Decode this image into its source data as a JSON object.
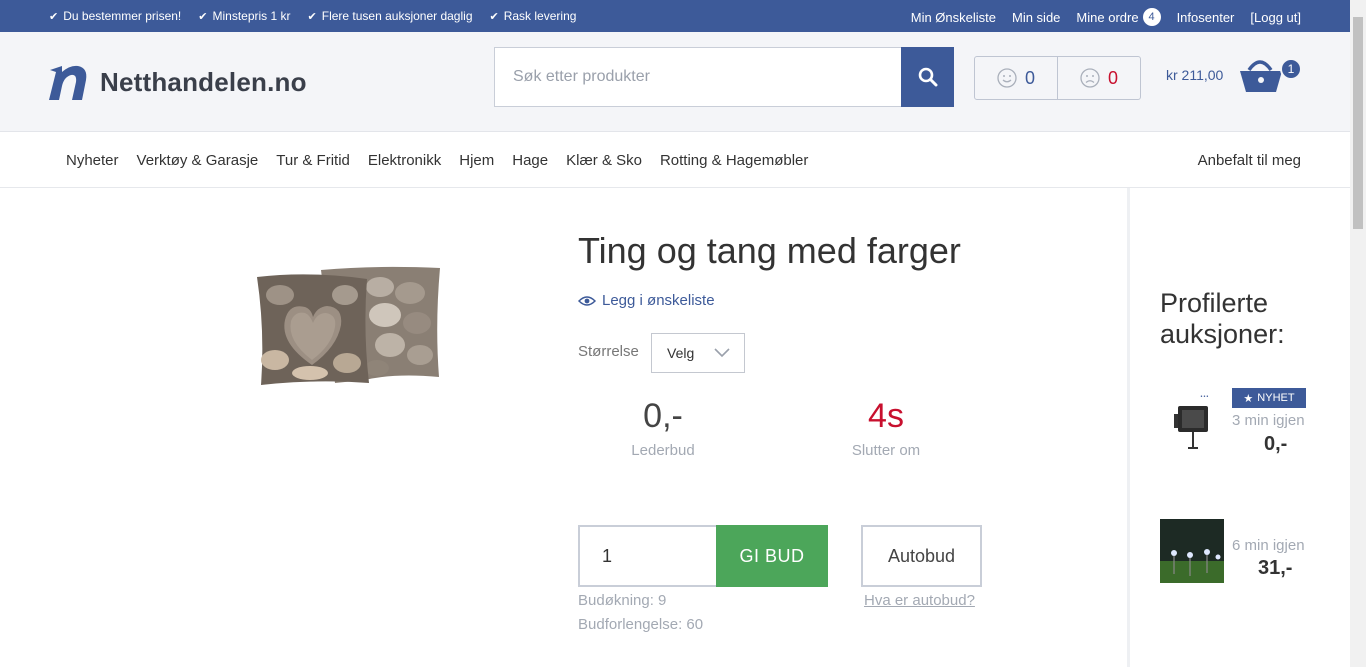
{
  "topbar": {
    "usps": [
      "Du bestemmer prisen!",
      "Minstepris 1 kr",
      "Flere tusen auksjoner daglig",
      "Rask levering"
    ],
    "links": {
      "wishlist": "Min Ønskeliste",
      "my_page": "Min side",
      "orders": "Mine ordre",
      "orders_count": "4",
      "info": "Infosenter",
      "logout": "[Logg ut]"
    }
  },
  "header": {
    "logo_text": "Netthandelen.no",
    "search_placeholder": "Søk etter produkter",
    "ratings": {
      "positive": "0",
      "negative": "0"
    },
    "cart_total": "kr 211,00",
    "cart_count": "1"
  },
  "nav": {
    "items": [
      "Nyheter",
      "Verktøy & Garasje",
      "Tur & Fritid",
      "Elektronikk",
      "Hjem",
      "Hage",
      "Klær & Sko",
      "Rotting & Hagemøbler"
    ],
    "right": "Anbefalt til meg"
  },
  "product": {
    "title": "Ting og tang med farger",
    "wishlist_label": "Legg i ønskeliste",
    "size_label": "Størrelse",
    "size_value": "Velg",
    "leading_bid": "0,-",
    "leading_bid_label": "Lederbud",
    "time_left": "4s",
    "time_left_label": "Slutter om",
    "bid_value": "1",
    "bid_button": "GI BUD",
    "autobid_button": "Autobud",
    "bid_increment": "Budøkning: 9",
    "bid_extension": "Budforlengelse: 60",
    "autobid_help": "Hva er autobud?"
  },
  "sidebar": {
    "title": "Profilerte auksjoner:",
    "items": [
      {
        "badge": "NYHET",
        "time": "3 min igjen",
        "price": "0,-"
      },
      {
        "time": "6 min igjen",
        "price": "31,-"
      }
    ]
  },
  "colors": {
    "brand": "#3d5a99",
    "bid_green": "#4ca65a",
    "alert_red": "#c8102e"
  }
}
